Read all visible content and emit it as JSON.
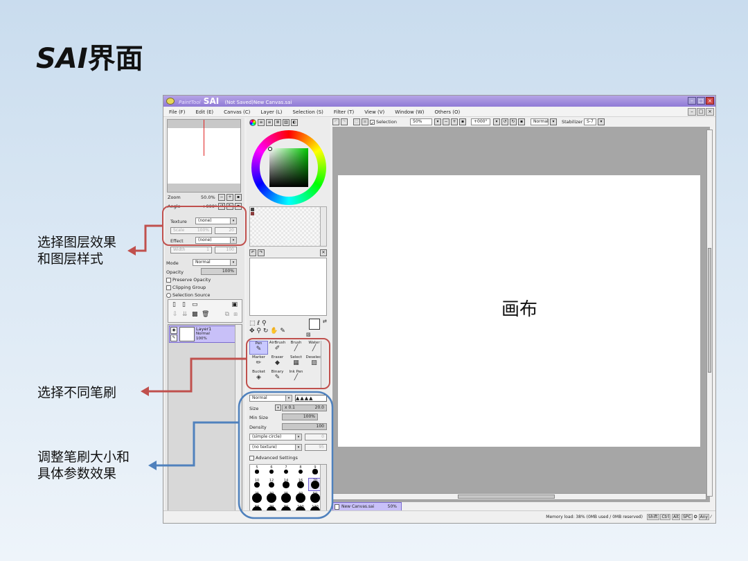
{
  "slide": {
    "title_latin": "SAI",
    "title_cjk": "界面"
  },
  "annotations": {
    "layer_effect": [
      "选择图层效果",
      "和图层样式"
    ],
    "brushes": [
      "选择不同笔刷"
    ],
    "brush_params": [
      "调整笔刷大小和",
      "具体参数效果"
    ],
    "canvas": "画布"
  },
  "colors": {
    "red_arrow": "#c0504d",
    "blue_arrow": "#4f81bd",
    "titlebar": "#9a86dc"
  },
  "app": {
    "title_paint": "Paint",
    "title_tool": "Tool",
    "title_sai": "SAI",
    "document_title": "(Not Saved)New Canvas.sai",
    "menu": [
      "File (F)",
      "Edit (E)",
      "Canvas (C)",
      "Layer (L)",
      "Selection (S)",
      "Filter (T)",
      "View (V)",
      "Window (W)",
      "Others (O)"
    ],
    "toolbar": {
      "selection_label": "Selection",
      "zoom_value": "50%",
      "angle_value": "+000°",
      "blend_value": "Normal",
      "stabilizer_label": "Stabilizer",
      "stabilizer_value": "S-7"
    },
    "navigator": {
      "zoom_label": "Zoom",
      "zoom_value": "50.0%",
      "angle_label": "Angle",
      "angle_value": "+000°"
    },
    "layer_panel": {
      "texture_label": "Texture",
      "texture_value": "(none)",
      "scale_label": "Scale",
      "scale_value": "100%",
      "scale_num": "20",
      "effect_label": "Effect",
      "effect_value": "(none)",
      "width_label": "Width",
      "width_value": "1",
      "width_num": "100",
      "mode_label": "Mode",
      "mode_value": "Normal",
      "opacity_label": "Opacity",
      "opacity_value": "100%",
      "preserve_opacity": "Preserve Opacity",
      "clipping_group": "Clipping Group",
      "selection_source": "Selection Source",
      "layer_name": "Layer1",
      "layer_mode": "Normal",
      "layer_opacity": "100%"
    },
    "tools": [
      {
        "label": "Pen",
        "icon": "✎"
      },
      {
        "label": "AirBrush",
        "icon": "✐"
      },
      {
        "label": "Brush",
        "icon": "╱"
      },
      {
        "label": "Water",
        "icon": "╱"
      },
      {
        "label": "Marker",
        "icon": "✏"
      },
      {
        "label": "Eraser",
        "icon": "◆"
      },
      {
        "label": "Select",
        "icon": "▦"
      },
      {
        "label": "Deselect",
        "icon": "▨"
      },
      {
        "label": "Bucket",
        "icon": "◈"
      },
      {
        "label": "Binary",
        "icon": "✎"
      },
      {
        "label": "Ink Pen",
        "icon": "╱"
      }
    ],
    "brush_settings": {
      "mode_value": "Normal",
      "size_label": "Size",
      "size_mult": "x 0.1",
      "size_value": "20.0",
      "min_size_label": "Min Size",
      "min_size_value": "100%",
      "density_label": "Density",
      "density_value": "100",
      "shape_value": "(simple circle)",
      "shape_num": "0",
      "texture_value": "(no texture)",
      "texture_num": "95",
      "advanced_settings": "Advanced Settings"
    },
    "brush_sizes": [
      "5",
      "6",
      "7",
      "8",
      "9",
      "10",
      "12",
      "14",
      "16",
      "20",
      "25",
      "30",
      "35",
      "40",
      "50",
      "60",
      "70",
      "80",
      "100",
      "120"
    ],
    "canvas_tab": "New Canvas.sai",
    "canvas_tab_zoom": "50%",
    "status": "Memory load: 38% (0MB used / 0MB reserved)",
    "status_keys": [
      "Shift",
      "Ctrl",
      "Alt",
      "SPC",
      "✪",
      "Any",
      "⁄"
    ]
  }
}
